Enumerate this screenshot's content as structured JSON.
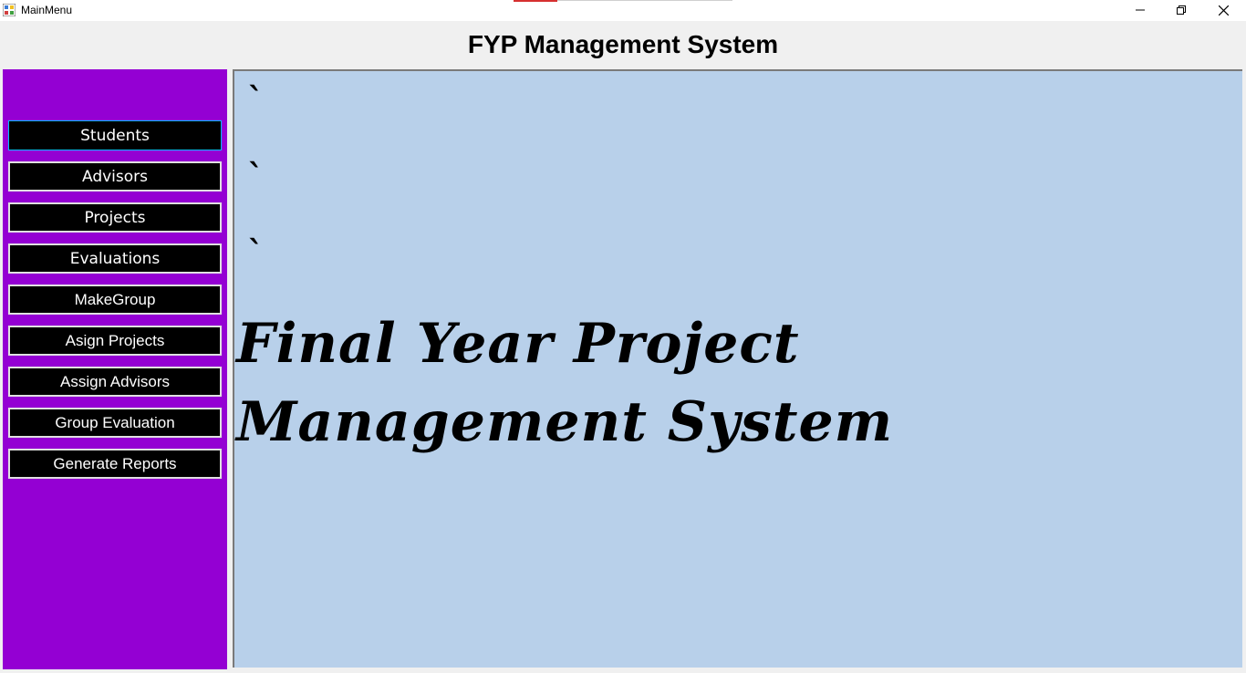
{
  "window": {
    "title": "MainMenu",
    "controls": [
      "minimize-icon",
      "restore-icon",
      "close-icon"
    ]
  },
  "header": {
    "title": "FYP Management System"
  },
  "sidebar": {
    "background": "#9400d3",
    "items": [
      {
        "label": "Students",
        "active": true
      },
      {
        "label": "Advisors"
      },
      {
        "label": "Projects"
      },
      {
        "label": "Evaluations"
      },
      {
        "label": "MakeGroup"
      },
      {
        "label": "Asign Projects"
      },
      {
        "label": "Assign Advisors"
      },
      {
        "label": "Group Evaluation"
      },
      {
        "label": "Generate Reports"
      }
    ]
  },
  "main": {
    "background": "#b8d0ea",
    "ticks": [
      "`",
      "`",
      "`"
    ],
    "title": "Final Year Project Management System"
  }
}
